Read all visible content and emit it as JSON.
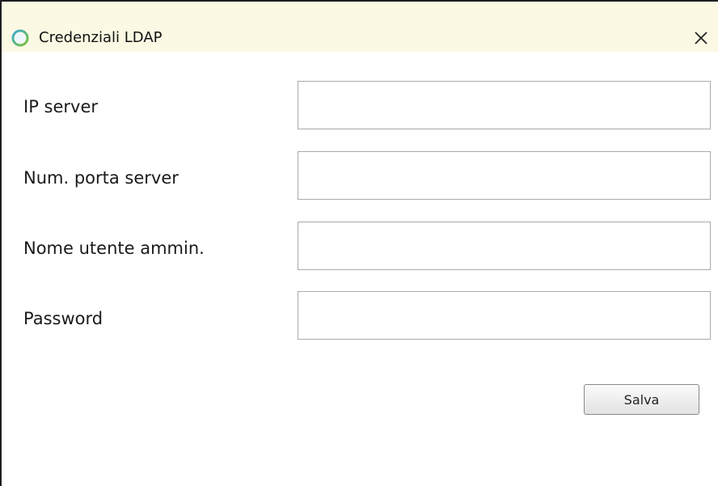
{
  "window": {
    "title": "Credenziali LDAP",
    "close_glyph": "×",
    "app_icon": "ring-logo-icon",
    "close_icon": "close-icon"
  },
  "form": {
    "fields": [
      {
        "label": "IP server",
        "value": "",
        "placeholder": ""
      },
      {
        "label": "Num. porta server",
        "value": "",
        "placeholder": ""
      },
      {
        "label": "Nome utente ammin.",
        "value": "",
        "placeholder": ""
      },
      {
        "label": "Password",
        "value": "",
        "placeholder": ""
      }
    ],
    "save_label": "Salva"
  },
  "colors": {
    "titlebar_bg": "#fbf9e3",
    "window_border": "#1e1e1e",
    "input_border": "#aaaaaa"
  }
}
